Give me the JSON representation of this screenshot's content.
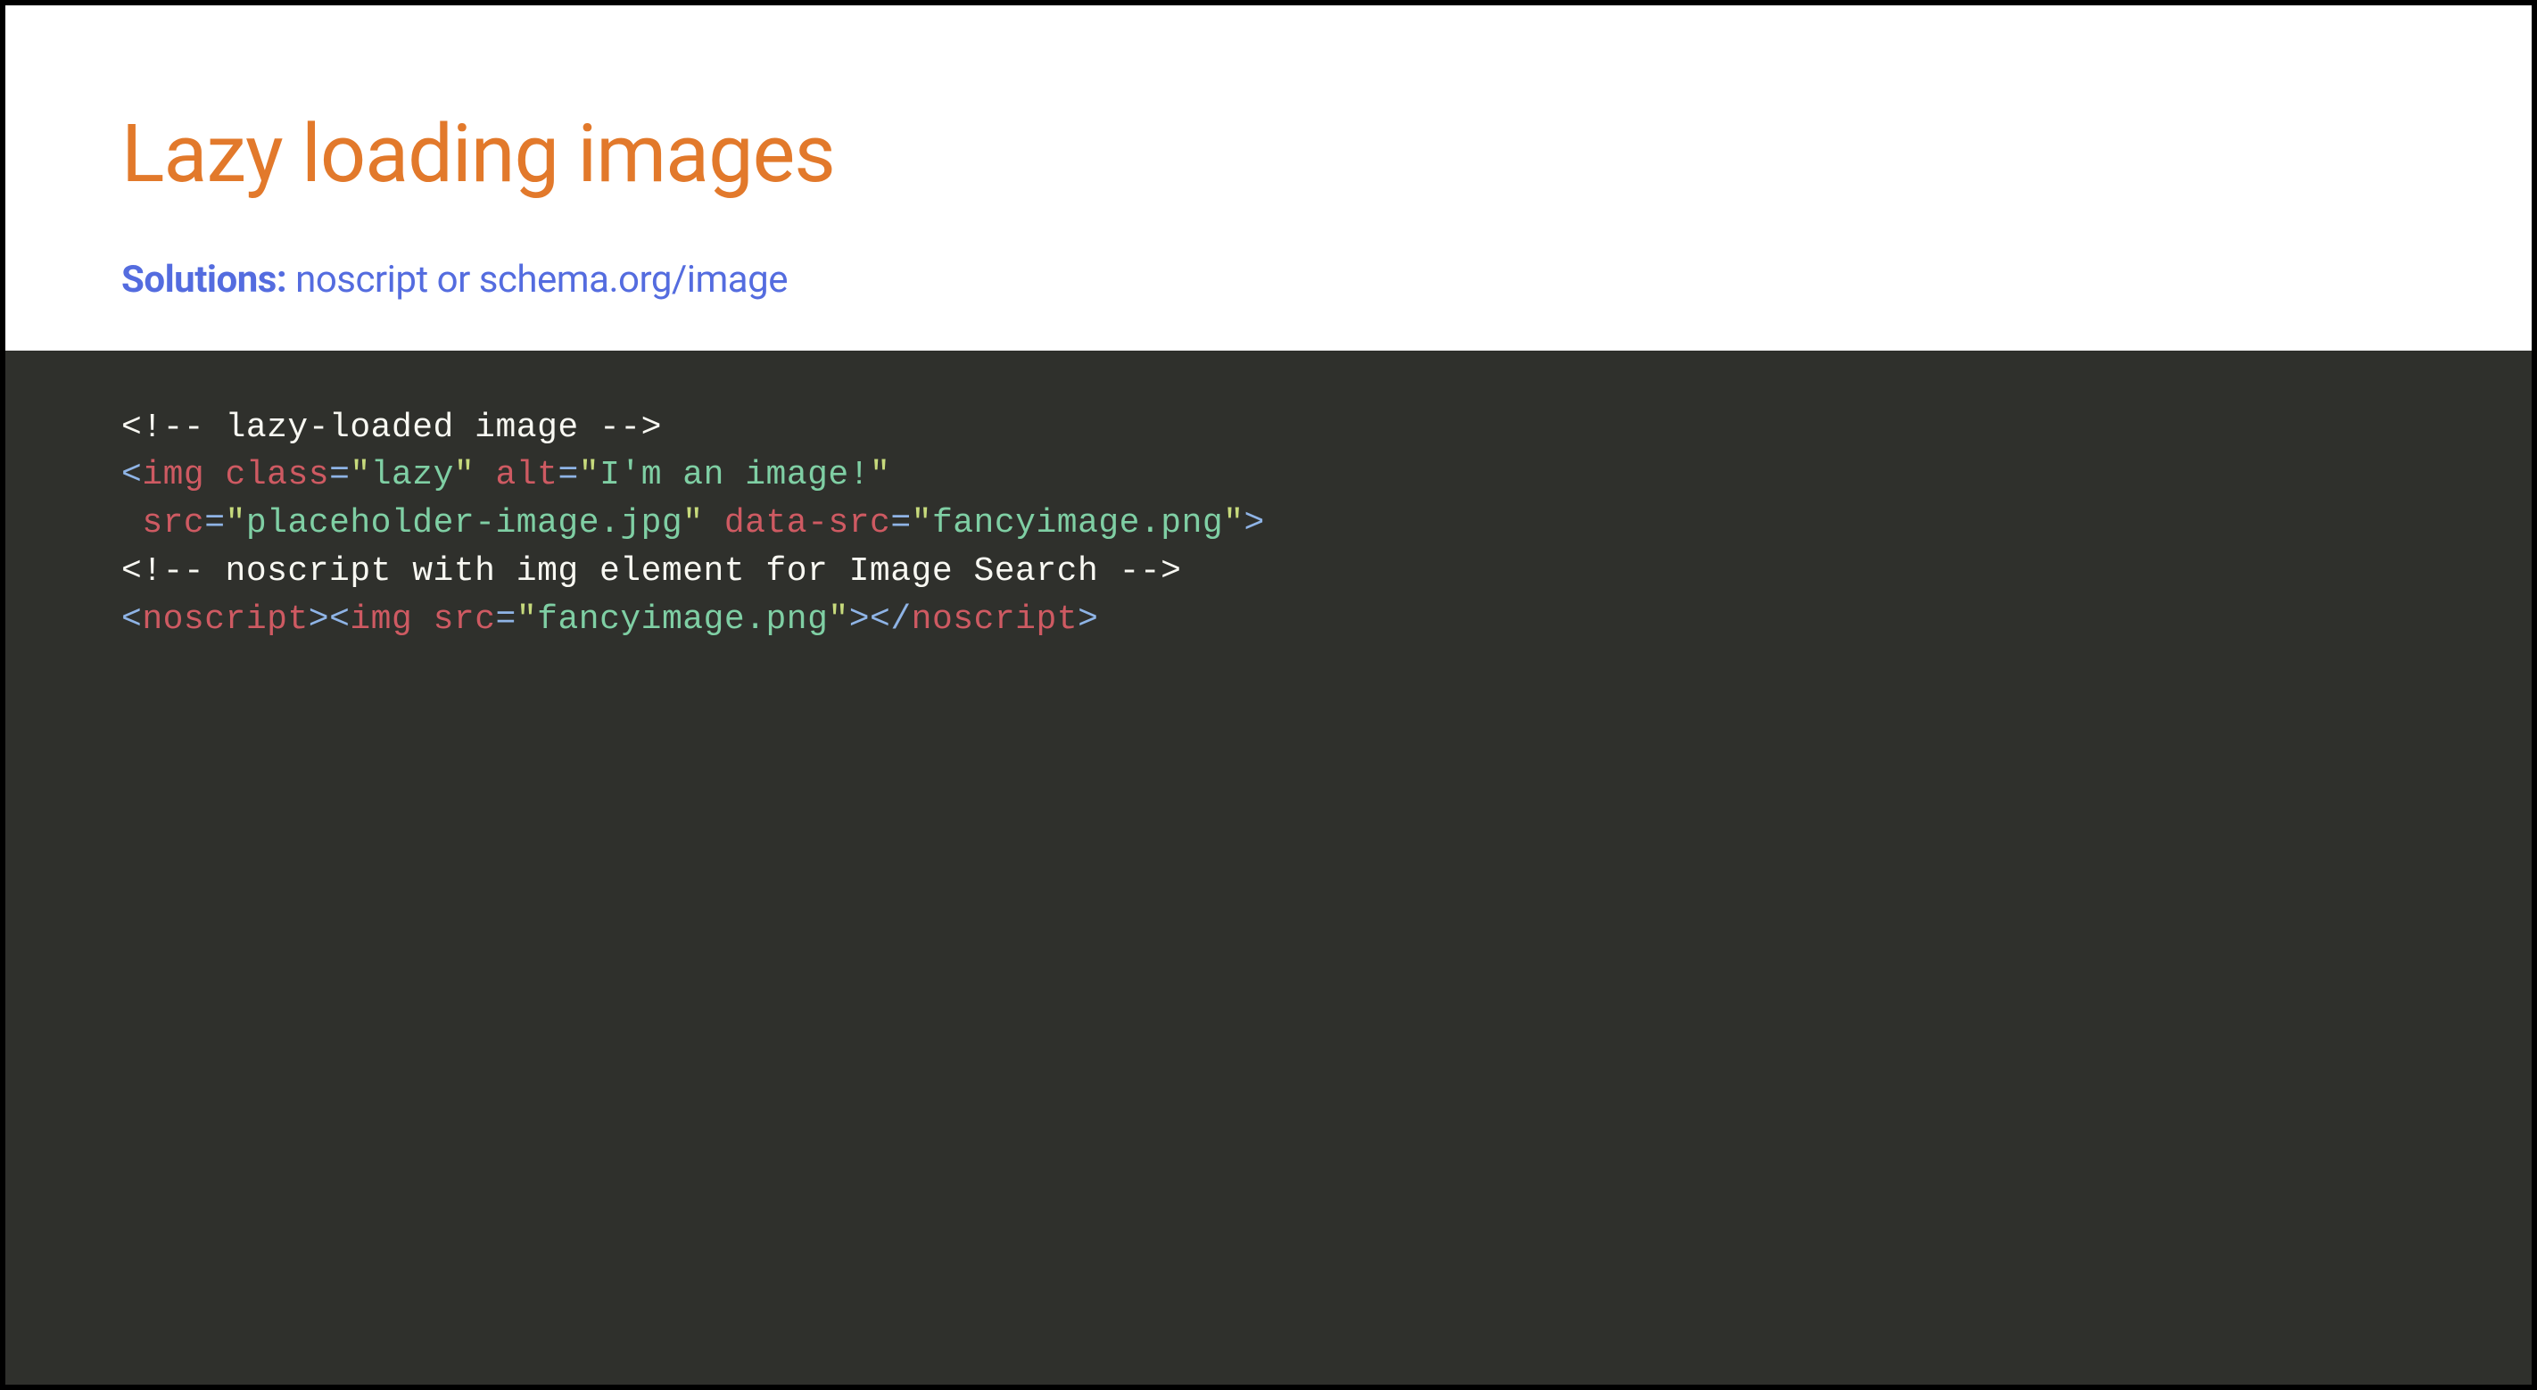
{
  "slide": {
    "title": "Lazy loading images",
    "subtitle_label": "Solutions:",
    "subtitle_text": " noscript or schema.org/image"
  },
  "code": {
    "l1_comment": "<!-- lazy-loaded image -->",
    "l2": {
      "open": "<",
      "tag": "img",
      "sp1": " ",
      "attr1": "class",
      "eq1": "=",
      "q1a": "\"",
      "v1": "lazy",
      "q1b": "\"",
      "sp2": " ",
      "attr2": "alt",
      "eq2": "=",
      "q2a": "\"",
      "v2": "I'm an image!",
      "q2b": "\""
    },
    "l3": {
      "sp": " ",
      "attr1": "src",
      "eq1": "=",
      "q1a": "\"",
      "v1": "placeholder-image.jpg",
      "q1b": "\"",
      "sp2": " ",
      "attr2": "data-src",
      "eq2": "=",
      "q2a": "\"",
      "v2": "fancyimage.png",
      "q2b": "\"",
      "close": ">"
    },
    "l4_comment": "<!-- noscript with img element for Image Search -->",
    "l5": {
      "open1": "<",
      "tag1": "noscript",
      "close1": ">",
      "open2": "<",
      "tag2": "img",
      "sp": " ",
      "attr": "src",
      "eq": "=",
      "q1": "\"",
      "v": "fancyimage.png",
      "q2": "\"",
      "close2": ">",
      "open3": "</",
      "tag3": "noscript",
      "close3": ">"
    }
  }
}
